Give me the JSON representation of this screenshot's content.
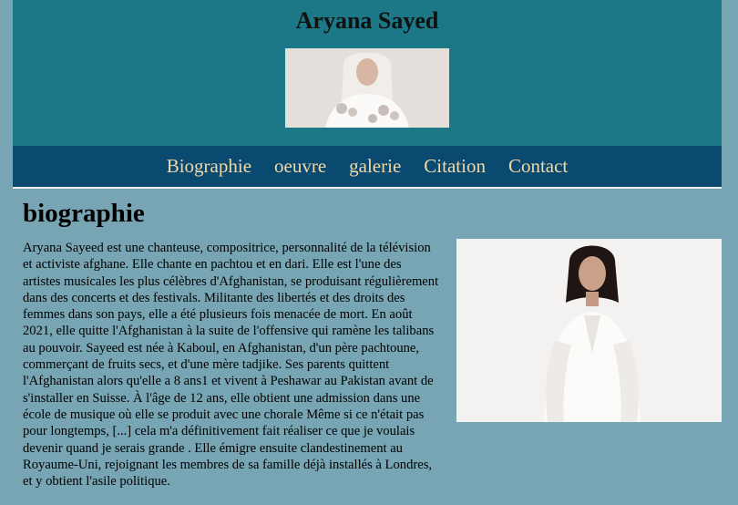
{
  "header": {
    "title": "Aryana Sayed",
    "hero_image": "portrait-photo-white-outfit"
  },
  "nav": {
    "items": [
      {
        "label": "Biographie"
      },
      {
        "label": "oeuvre"
      },
      {
        "label": "galerie"
      },
      {
        "label": "Citation"
      },
      {
        "label": "Contact"
      }
    ]
  },
  "main": {
    "section_title": "biographie",
    "bio_text": "Aryana Sayeed est une chanteuse, compositrice, personnalité de la télévision et activiste afghane. Elle chante en pachtou et en dari. Elle est l'une des artistes musicales les plus célèbres d'Afghanistan, se produisant régulièrement dans des concerts et des festivals. Militante des libertés et des droits des femmes dans son pays, elle a été plusieurs fois menacée de mort. En août 2021, elle quitte l'Afghanistan à la suite de l'offensive qui ramène les talibans au pouvoir. Sayeed est née à Kaboul, en Afghanistan, d'un père pachtoune, commerçant de fruits secs, et d'une mère tadjike. Ses parents quittent l'Afghanistan alors qu'elle a 8 ans1 et vivent à Peshawar au Pakistan avant de s'installer en Suisse. À l'âge de 12 ans, elle obtient une admission dans une école de musique où elle se produit avec une chorale Même si ce n'était pas pour longtemps, [...] cela m'a définitivement fait réaliser ce que je voulais devenir quand je serais grande . Elle émigre ensuite clandestinement au Royaume-Uni, rejoignant les membres de sa famille déjà installés à Londres, et y obtient l'asile politique.",
    "bio_image": "portrait-photo-white-suit"
  },
  "colors": {
    "page_background": "#77a5b3",
    "header_background": "#1c7887",
    "nav_background": "#0b4a70",
    "nav_text": "#f0d9a8"
  }
}
